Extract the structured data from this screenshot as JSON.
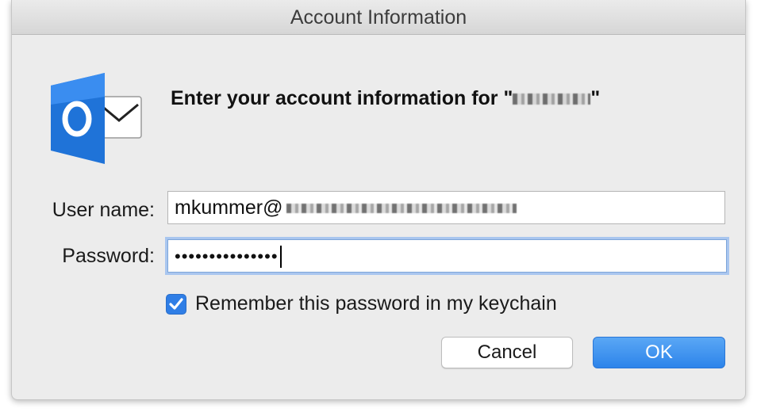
{
  "window": {
    "title": "Account Information"
  },
  "app_icon": {
    "name": "outlook-icon",
    "letter": "O",
    "brand_color": "#1f73d8",
    "accent_color": "#3a8df0"
  },
  "prompt": {
    "heading_prefix": "Enter your account information for \"",
    "heading_suffix": "\""
  },
  "form": {
    "username_label": "User name:",
    "username_value": "mkummer@",
    "password_label": "Password:",
    "password_value": "•••••••••••••••"
  },
  "remember": {
    "checked": true,
    "label": "Remember this password in my keychain"
  },
  "buttons": {
    "cancel_label": "Cancel",
    "ok_label": "OK"
  },
  "colors": {
    "window_bg": "#ececec",
    "accent": "#2f7ee6",
    "focus_ring": "#a9c6ef"
  }
}
